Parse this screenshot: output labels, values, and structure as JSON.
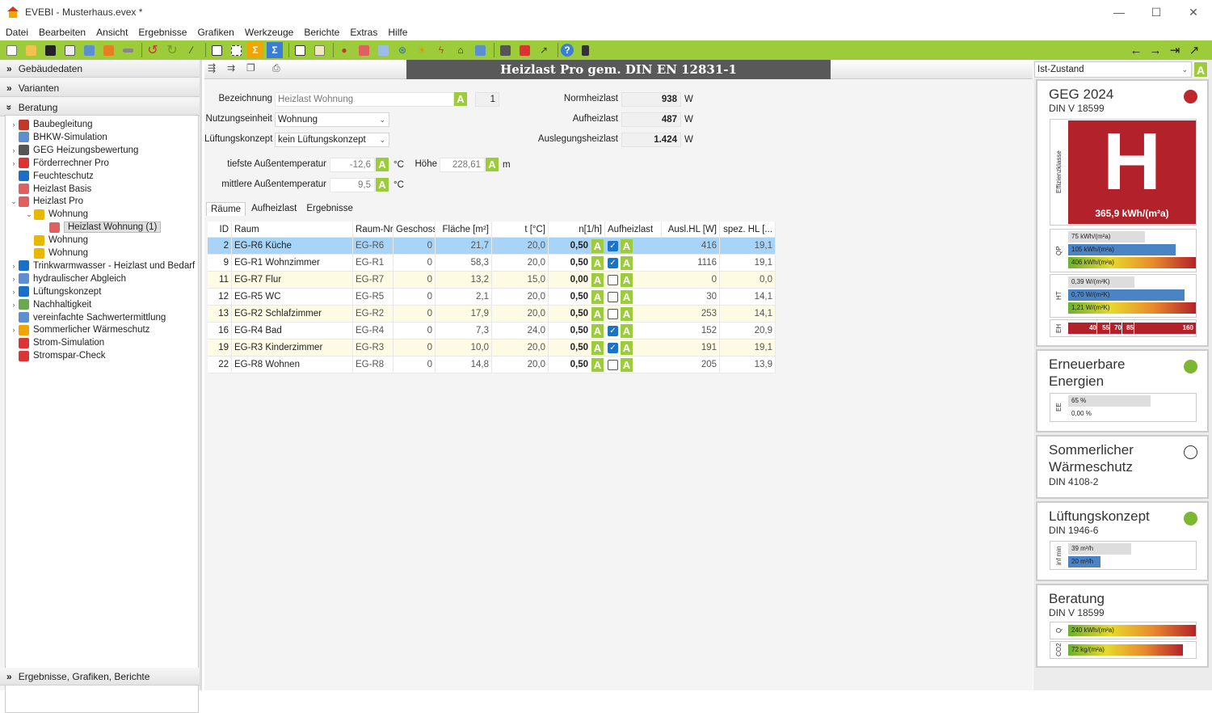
{
  "window": {
    "title": "EVEBI - Musterhaus.evex *",
    "min": "—",
    "max": "☐",
    "close": "✕"
  },
  "menu": [
    "Datei",
    "Bearbeiten",
    "Ansicht",
    "Ergebnisse",
    "Grafiken",
    "Werkzeuge",
    "Berichte",
    "Extras",
    "Hilfe"
  ],
  "left": {
    "sections": {
      "gebaeudedaten": "Gebäudedaten",
      "varianten": "Varianten",
      "beratung": "Beratung",
      "ergebnisse": "Ergebnisse, Grafiken, Berichte"
    },
    "tree": [
      {
        "label": "Baubegleitung",
        "depth": 0,
        "exp": "›",
        "icon": "#c0392b"
      },
      {
        "label": "BHKW-Simulation",
        "depth": 0,
        "exp": "",
        "icon": "#5b8fd1"
      },
      {
        "label": "GEG Heizungsbewertung",
        "depth": 0,
        "exp": "›",
        "icon": "#555"
      },
      {
        "label": "Förderrechner Pro",
        "depth": 0,
        "exp": "›",
        "icon": "#d33"
      },
      {
        "label": "Feuchteschutz",
        "depth": 0,
        "exp": "",
        "icon": "#1a6fc8"
      },
      {
        "label": "Heizlast Basis",
        "depth": 0,
        "exp": "",
        "icon": "#e06060"
      },
      {
        "label": "Heizlast Pro",
        "depth": 0,
        "exp": "⌄",
        "icon": "#e06060"
      },
      {
        "label": "Wohnung",
        "depth": 1,
        "exp": "⌄",
        "icon": "#e6b800"
      },
      {
        "label": "Heizlast Wohnung (1)",
        "depth": 2,
        "exp": "",
        "icon": "#e06060",
        "selected": true
      },
      {
        "label": "Wohnung",
        "depth": 1,
        "exp": "",
        "icon": "#e6b800"
      },
      {
        "label": "Wohnung",
        "depth": 1,
        "exp": "",
        "icon": "#e6b800"
      },
      {
        "label": "Trinkwarmwasser - Heizlast und Bedarf",
        "depth": 0,
        "exp": "›",
        "icon": "#1a6fc8"
      },
      {
        "label": "hydraulischer Abgleich",
        "depth": 0,
        "exp": "›",
        "icon": "#5b8fd1"
      },
      {
        "label": "Lüftungskonzept",
        "depth": 0,
        "exp": "›",
        "icon": "#1a6fc8"
      },
      {
        "label": "Nachhaltigkeit",
        "depth": 0,
        "exp": "›",
        "icon": "#6aa84f"
      },
      {
        "label": "vereinfachte Sachwertermittlung",
        "depth": 0,
        "exp": "",
        "icon": "#5b8fd1"
      },
      {
        "label": "Sommerlicher Wärmeschutz",
        "depth": 0,
        "exp": "›",
        "icon": "#f0a500"
      },
      {
        "label": "Strom-Simulation",
        "depth": 0,
        "exp": "",
        "icon": "#d33"
      },
      {
        "label": "Stromspar-Check",
        "depth": 0,
        "exp": "",
        "icon": "#d33"
      }
    ]
  },
  "main": {
    "title": "Heizlast Pro gem. DIN EN 12831-1",
    "bezeichnung_label": "Bezeichnung",
    "bezeichnung_value": "Heizlast Wohnung",
    "bezeichnung_num": "1",
    "nutzung_label": "Nutzungseinheit",
    "nutzung_value": "Wohnung",
    "lueftung_label": "Lüftungskonzept",
    "lueftung_value": "kein Lüftungskonzept",
    "tiefste_label": "tiefste Außentemperatur",
    "tiefste_value": "-12,6",
    "tiefste_unit": "°C",
    "hoehe_label": "Höhe",
    "hoehe_value": "228,61",
    "hoehe_unit": "m",
    "mittlere_label": "mittlere Außentemperatur",
    "mittlere_value": "9,5",
    "mittlere_unit": "°C",
    "norm_label": "Normheizlast",
    "norm_value": "938",
    "norm_unit": "W",
    "aufheiz_label": "Aufheizlast",
    "aufheiz_value": "487",
    "aufheiz_unit": "W",
    "ausleg_label": "Auslegungsheizlast",
    "ausleg_value": "1.424",
    "ausleg_unit": "W",
    "a": "A",
    "tabs": [
      "Räume",
      "Aufheizlast",
      "Ergebnisse"
    ],
    "columns": [
      "ID",
      "Raum",
      "Raum-Nr.",
      "Geschoss",
      "Fläche [m²]",
      "t [°C]",
      "n[1/h]",
      "Aufheizlast",
      "Ausl.HL [W]",
      "spez. HL [..."
    ],
    "rows": [
      {
        "id": "2",
        "raum": "EG-R6 Küche",
        "nr": "EG-R6",
        "g": "0",
        "f": "21,7",
        "t": "20,0",
        "n": "0,50",
        "auf": true,
        "hl": "416",
        "spez": "19,1"
      },
      {
        "id": "9",
        "raum": "EG-R1 Wohnzimmer",
        "nr": "EG-R1",
        "g": "0",
        "f": "58,3",
        "t": "20,0",
        "n": "0,50",
        "auf": true,
        "hl": "1116",
        "spez": "19,1"
      },
      {
        "id": "11",
        "raum": "EG-R7 Flur",
        "nr": "EG-R7",
        "g": "0",
        "f": "13,2",
        "t": "15,0",
        "n": "0,00",
        "auf": false,
        "hl": "0",
        "spez": "0,0"
      },
      {
        "id": "12",
        "raum": "EG-R5 WC",
        "nr": "EG-R5",
        "g": "0",
        "f": "2,1",
        "t": "20,0",
        "n": "0,50",
        "auf": false,
        "hl": "30",
        "spez": "14,1"
      },
      {
        "id": "13",
        "raum": "EG-R2 Schlafzimmer",
        "nr": "EG-R2",
        "g": "0",
        "f": "17,9",
        "t": "20,0",
        "n": "0,50",
        "auf": false,
        "hl": "253",
        "spez": "14,1"
      },
      {
        "id": "16",
        "raum": "EG-R4 Bad",
        "nr": "EG-R4",
        "g": "0",
        "f": "7,3",
        "t": "24,0",
        "n": "0,50",
        "auf": true,
        "hl": "152",
        "spez": "20,9"
      },
      {
        "id": "19",
        "raum": "EG-R3 Kinderzimmer",
        "nr": "EG-R3",
        "g": "0",
        "f": "10,0",
        "t": "20,0",
        "n": "0,50",
        "auf": true,
        "hl": "191",
        "spez": "19,1"
      },
      {
        "id": "22",
        "raum": "EG-R8 Wohnen",
        "nr": "EG-R8",
        "g": "0",
        "f": "14,8",
        "t": "20,0",
        "n": "0,50",
        "auf": false,
        "hl": "205",
        "spez": "13,9"
      }
    ]
  },
  "right": {
    "state": "Ist-Zustand",
    "geg": {
      "title": "GEG 2024",
      "sub": "DIN V 18599",
      "letter": "H",
      "value": "365,9 kWh/(m²a)",
      "vlabel": "Effizienzklasse",
      "qp_label": "QP",
      "qp": [
        "75 kWh/(m²a)",
        "105 kWh/(m²a)",
        "406 kWh/(m²a)"
      ],
      "ht_label": "HT",
      "ht": [
        "0,39 W/(m²K)",
        "0,70 W/(m²K)",
        "1,21 W/(m²K)"
      ],
      "eh_label": "EH",
      "eh": [
        "40",
        "55",
        "70",
        "85",
        "160"
      ],
      "status_color": "#c0272d"
    },
    "ee": {
      "title": "Erneuerbare Energien",
      "label": "EE",
      "values": [
        "65 %",
        "0,00 %"
      ],
      "status_color": "#7cb82f"
    },
    "sw": {
      "title": "Sommerlicher Wärmeschutz",
      "sub": "DIN 4108-2"
    },
    "lk": {
      "title": "Lüftungskonzept",
      "sub": "DIN 1946-6",
      "label": "inf min",
      "values": [
        "39 m³/h",
        "20 m³/h"
      ],
      "status_color": "#7cb82f"
    },
    "ber": {
      "title": "Beratung",
      "sub": "DIN V 18599",
      "q_label": "Q",
      "q": "240 kWh/(m²a)",
      "co2_label": "CO2",
      "co2": "72 kg/(m²a)"
    }
  }
}
